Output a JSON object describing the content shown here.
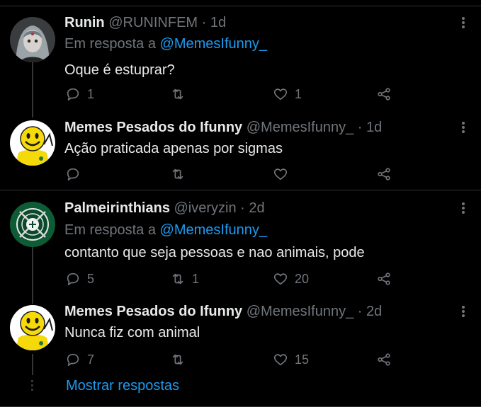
{
  "tweets": [
    {
      "name": "Runin",
      "handle": "@RUNINFEM",
      "time": "· 1d",
      "reply_prefix": "Em resposta a",
      "reply_handle": "@MemesIfunny_",
      "text": "Oque é estuprar?",
      "replies": "1",
      "retweets": "",
      "likes": "1"
    },
    {
      "name": "Memes Pesados do Ifunny",
      "handle": "@MemesIfunny_",
      "time": "· 1d",
      "text": "Ação praticada apenas por sigmas",
      "replies": "",
      "retweets": "",
      "likes": ""
    },
    {
      "name": "Palmeirinthians",
      "handle": "@iveryzin",
      "time": "· 2d",
      "reply_prefix": "Em resposta a",
      "reply_handle": "@MemesIfunny_",
      "text": "contanto que seja pessoas e nao animais, pode",
      "replies": "5",
      "retweets": "1",
      "likes": "20"
    },
    {
      "name": "Memes Pesados do Ifunny",
      "handle": "@MemesIfunny_",
      "time": "· 2d",
      "text": "Nunca fiz com animal",
      "replies": "7",
      "retweets": "",
      "likes": "15"
    }
  ],
  "show_replies": "Mostrar respostas",
  "colors": {
    "background": "#000000",
    "accent": "#1d9bf0",
    "muted": "#71767b",
    "text": "#e7e9ea"
  },
  "icons": [
    "reply-icon",
    "retweet-icon",
    "like-icon",
    "share-icon",
    "more-icon"
  ]
}
